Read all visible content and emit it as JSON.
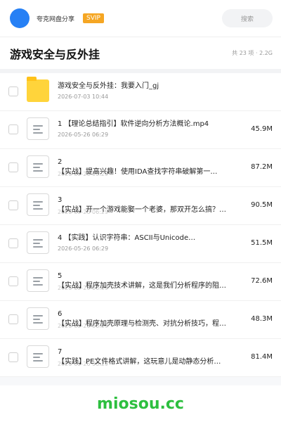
{
  "header": {
    "username": "夸克网盘分享",
    "badge": "SVIP",
    "search_placeholder": "搜索",
    "avatar_color": "#2680f5"
  },
  "folder": {
    "title": "游戏安全与反外挂",
    "meta": "共 23 项 · 2.2G"
  },
  "items": [
    {
      "type": "folder",
      "icon": "folder-icon",
      "name": "游戏安全与反外挂：我要入门_gj",
      "date": "2026-07-03 10:44",
      "size": ""
    },
    {
      "type": "file",
      "icon": "document-icon",
      "name": "1 【理论总结指引】软件逆向分析方法概论.mp4",
      "date": "2026-05-26 06:29",
      "size": "45.9M"
    },
    {
      "type": "file",
      "icon": "document-icon",
      "name": "2",
      "name2": "【实战】提高兴趣！使用IDA查找字符串破解第一…",
      "date": "2026-05-26 06:29",
      "size": "87.2M"
    },
    {
      "type": "file",
      "icon": "document-icon",
      "name": "3",
      "name2": "【实战】开一个游戏能娶一个老婆，那双开怎么搞？…",
      "date": "2026-05-26 06:29",
      "size": "90.5M"
    },
    {
      "type": "file",
      "icon": "document-icon",
      "name": "4 【实践】认识字符串：ASCII与Unicode…",
      "date": "2026-05-26 06:29",
      "size": "51.5M"
    },
    {
      "type": "file",
      "icon": "document-icon",
      "name": "5",
      "name2": "【实战】程序加壳技术讲解，这是我们分析程序的阻…",
      "date": "2026-05-26 06:29",
      "size": "72.6M"
    },
    {
      "type": "file",
      "icon": "document-icon",
      "name": "6",
      "name2": "【实战】程序加壳原理与检测壳、对抗分析技巧，程…",
      "date": "2026-05-26 06:29",
      "size": "48.3M"
    },
    {
      "type": "file",
      "icon": "document-icon",
      "name": "7",
      "name2": "【实践】PE文件格式讲解，这玩意儿是动静态分析…",
      "date": "2026-05-26 06:29",
      "size": "81.4M"
    }
  ],
  "watermark": "miosou.cc",
  "colors": {
    "accent": "#2680f5",
    "svip": "#f5a623",
    "watermark": "#2dbf3f",
    "folder": "#ffd43b"
  }
}
